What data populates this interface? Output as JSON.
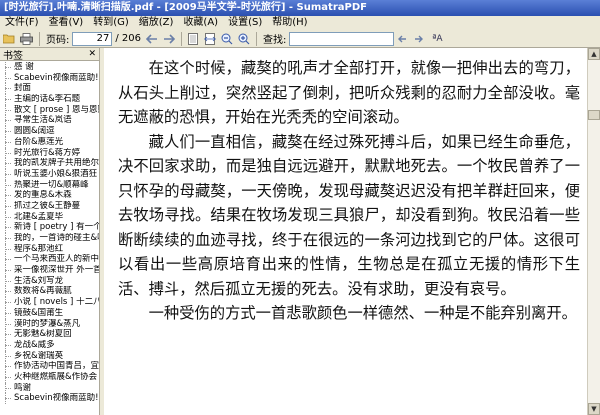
{
  "window": {
    "title": "[时光旅行].叶喃.清晰扫描版.pdf - [2009马半文学-时光旅行] - SumatraPDF"
  },
  "menu": [
    "文件(F)",
    "查看(V)",
    "转到(G)",
    "缩放(Z)",
    "收藏(A)",
    "设置(S)",
    "帮助(H)"
  ],
  "toolbar": {
    "page_label": "页码:",
    "page_value": "27",
    "page_total": "/ 206",
    "find_label": "查找:",
    "find_value": "",
    "case_label": "ªA"
  },
  "sidebar": {
    "title": "书签",
    "items": [
      "感 谢",
      "Scabevin视像雨蓝助!",
      "封面",
      "主编的话&李石题",
      "散文 [ prose ] 恩与恩赋",
      "寻常生活&岚语",
      "圆圆&阔逗",
      "台阶&惠莲光",
      "时光旅行&蒋方婷",
      "我的凯发牌子共用绝尔",
      "听说玉婆小娘&狠酒狂",
      "热聚进一切&顺幕峰",
      "发的重息&木森",
      "抓过之彼&王静蔓",
      "北建&孟夏毕",
      "新诗 [ poetry ] 有一个名",
      "我的，一首诗的碰主&吗",
      "程序&那池红",
      "一个马来西亚人的新中",
      "采一像视深世开 外一首",
      "生活&刘写龙",
      "数数将&再薇腻",
      "小说 [ novels ] 十二八九",
      "镜鼓&国莆生",
      "漠时的梦瀑&蒸凡",
      "无影魅&树夏回",
      "龙战&威多",
      "乡祝&谢瑞英",
      "作协活动中国青吕，宜",
      "火种继燃瓶展&作协会",
      "鸣谢",
      "Scabevin视像雨蓝助!"
    ]
  },
  "document": {
    "paragraphs": [
      "在这个时候，藏獒的吼声才全部打开，就像一把伸出去的弯刀，从石头上削过，突然竖起了倒刺，把听众残剩的忍耐力全部没收。毫无遮蔽的恐惧，开始在光秃秃的空间滚动。",
      "藏人们一直相信，藏獒在经过殊死搏斗后，如果已经生命垂危，决不回家求助，而是独自远远避开，默默地死去。一个牧民曾养了一只怀孕的母藏獒，一天傍晚，发现母藏獒迟迟没有把羊群赶回来，便去牧场寻找。结果在牧场发现三具狼尸，却没看到狗。牧民沿着一些断断续续的血迹寻找，终于在很远的一条河边找到它的尸体。这很可以看出一些高原培育出来的性情，生物总是在孤立无援的情形下生活、搏斗，然后孤立无援的死去。没有求助，更没有哀号。",
      "一种受伤的方式一首悲歌颜色一样德然、一种是不能弃别离开。"
    ]
  }
}
